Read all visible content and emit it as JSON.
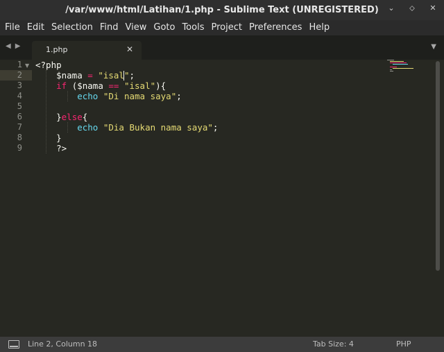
{
  "window": {
    "title": "/var/www/html/Latihan/1.php - Sublime Text (UNREGISTERED)"
  },
  "menu": [
    "File",
    "Edit",
    "Selection",
    "Find",
    "View",
    "Goto",
    "Tools",
    "Project",
    "Preferences",
    "Help"
  ],
  "tab": {
    "label": "1.php"
  },
  "editor": {
    "current_line": 2,
    "code": [
      "<?php",
      "$nama = \"isal\";",
      "if ($nama == \"isal\"){",
      "echo \"Di nama saya\";",
      "",
      "}else{",
      "echo \"Dia Bukan nama saya\";",
      "}",
      "?>"
    ],
    "line_numbers": [
      "1",
      "2",
      "3",
      "4",
      "5",
      "6",
      "7",
      "8",
      "9"
    ]
  },
  "status": {
    "position": "Line 2, Column 18",
    "tab_size": "Tab Size: 4",
    "syntax": "PHP"
  },
  "colors": {
    "background": "#272822",
    "keyword": "#f92672",
    "string": "#e6db74",
    "function": "#66d9ef",
    "text": "#f8f8f2"
  }
}
